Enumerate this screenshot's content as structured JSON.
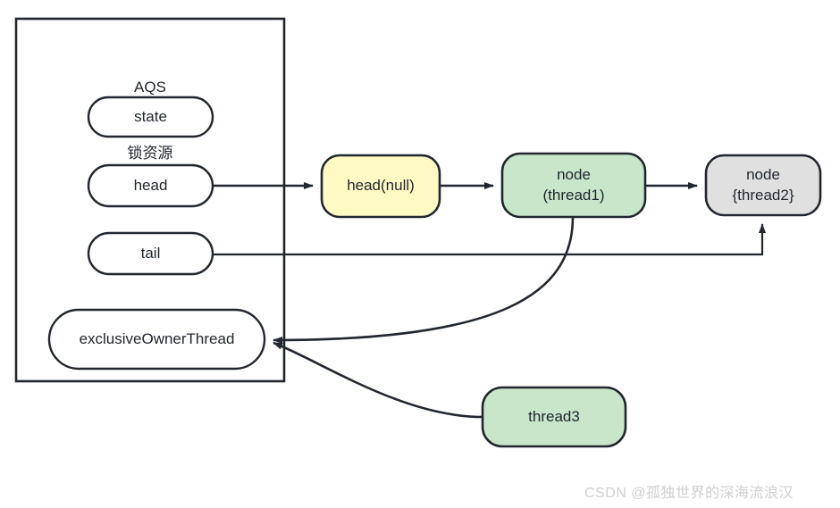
{
  "diagram": {
    "title_line1": "AQS",
    "title_line2": "锁资源",
    "container_label": "AQS 锁资源",
    "fields": [
      {
        "label": "state"
      },
      {
        "label": "head"
      },
      {
        "label": "tail"
      },
      {
        "label": "exclusiveOwnerThread"
      }
    ],
    "queue_nodes": [
      {
        "label": "head(null)",
        "line1": "head(null)",
        "line2": "",
        "fill": "#FFF9C4"
      },
      {
        "label": "node (thread1)",
        "line1": "node",
        "line2": "(thread1)",
        "fill": "#C8E6C9"
      },
      {
        "label": "node {thread2}",
        "line1": "node",
        "line2": "{thread2}",
        "fill": "#E0E0E0"
      }
    ],
    "floating_nodes": [
      {
        "label": "thread3",
        "fill": "#C8E6C9"
      }
    ],
    "colors": {
      "stroke": "#222730",
      "background": "#ffffff",
      "yellow": "#FFF9C4",
      "green": "#C8E6C9",
      "gray": "#E0E0E0",
      "text": "#222730",
      "watermark": "#cfcfcf"
    },
    "edges": [
      {
        "from": "head",
        "to": "head(null)",
        "style": "straight-arrow"
      },
      {
        "from": "head(null)",
        "to": "node (thread1)",
        "style": "straight-arrow"
      },
      {
        "from": "node (thread1)",
        "to": "node {thread2}",
        "style": "straight-arrow"
      },
      {
        "from": "tail",
        "to": "node {thread2}",
        "style": "elbow-arrow"
      },
      {
        "from": "node (thread1)",
        "to": "exclusiveOwnerThread",
        "style": "curved-arrow"
      },
      {
        "from": "thread3",
        "to": "exclusiveOwnerThread",
        "style": "curved-arrow"
      }
    ]
  },
  "watermark": {
    "text": "CSDN @孤独世界的深海流浪汉"
  }
}
